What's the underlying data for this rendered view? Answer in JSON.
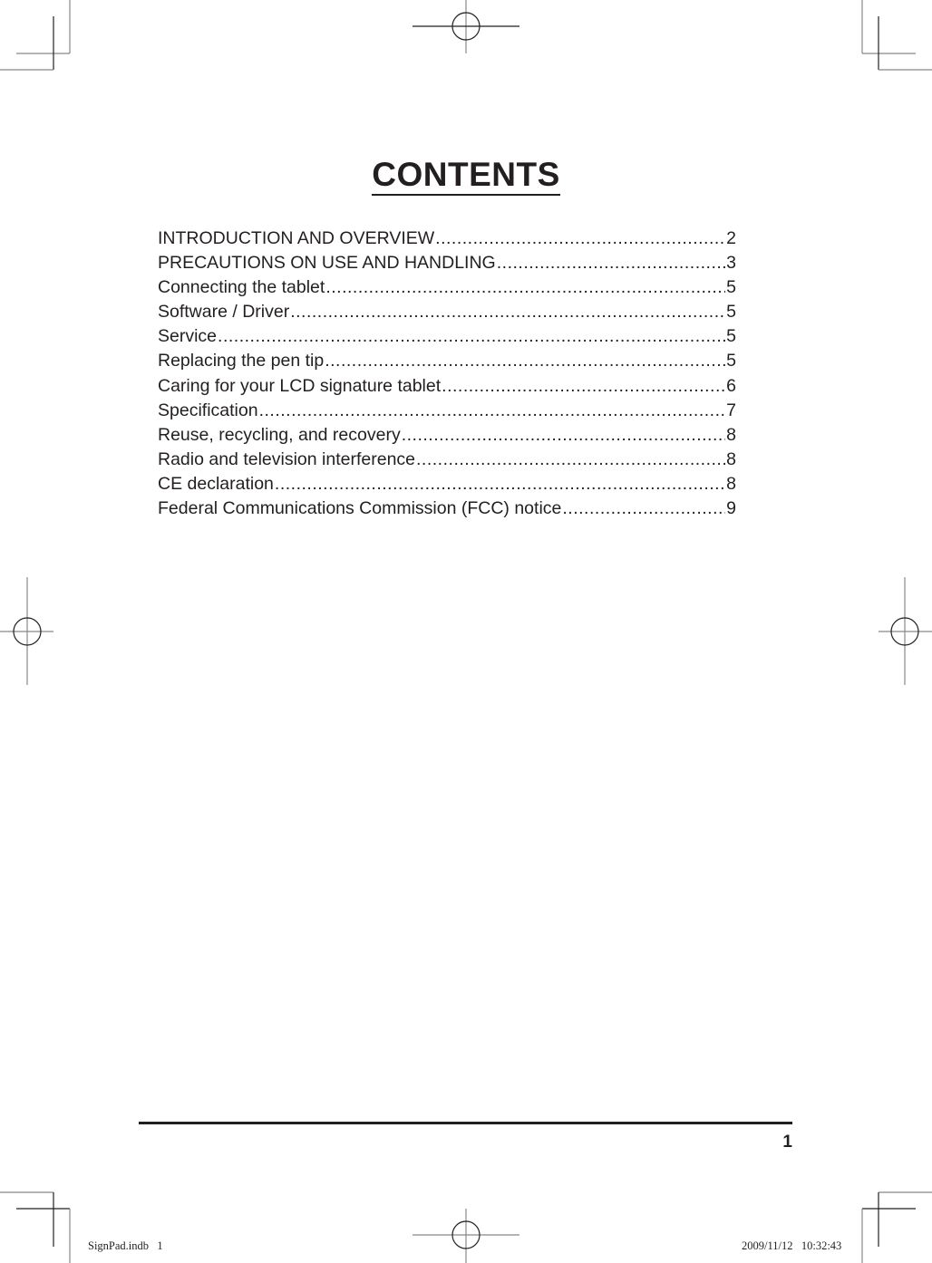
{
  "page": {
    "title": "CONTENTS",
    "toc": [
      {
        "label": "INTRODUCTION AND OVERVIEW ",
        "page": "2"
      },
      {
        "label": "PRECAUTIONS ON USE AND HANDLING",
        "page": "3"
      },
      {
        "label": "Connecting the tablet ",
        "page": "5"
      },
      {
        "label": "Software / Driver",
        "page": "5"
      },
      {
        "label": "Service",
        "page": "5"
      },
      {
        "label": "Replacing the pen tip",
        "page": "5"
      },
      {
        "label": "Caring for your LCD signature tablet",
        "page": "6"
      },
      {
        "label": "Specification",
        "page": "7"
      },
      {
        "label": "Reuse, recycling, and recovery",
        "page": "8"
      },
      {
        "label": "Radio and television interference ",
        "page": "8"
      },
      {
        "label": "CE declaration ",
        "page": "8"
      },
      {
        "label": "Federal Communications Commission (FCC) notice",
        "page": "9"
      }
    ],
    "page_number": "1"
  },
  "slug": {
    "file": "SignPad.indb   1",
    "timestamp": "2009/11/12   10:32:43"
  },
  "colors": {
    "text": "#231f20",
    "crop_marks": "#231f20"
  }
}
